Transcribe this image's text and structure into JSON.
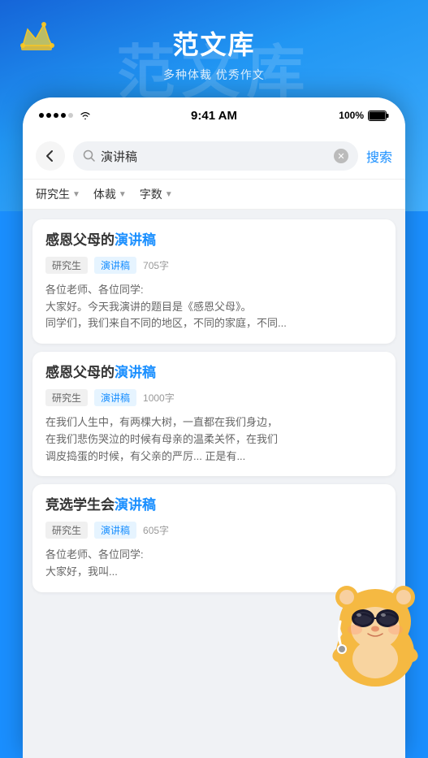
{
  "app": {
    "title": "范文库",
    "subtitle": "多种体裁 优秀作文",
    "watermark": "范文库"
  },
  "statusBar": {
    "time": "9:41 AM",
    "battery": "100%",
    "dots": [
      "•",
      "•",
      "•",
      "•",
      "•"
    ]
  },
  "search": {
    "placeholder": "演讲稿",
    "query": "演讲稿",
    "button": "搜索"
  },
  "filters": [
    {
      "label": "研究生",
      "id": "grade"
    },
    {
      "label": "体裁",
      "id": "genre"
    },
    {
      "label": "字数",
      "id": "wordcount"
    }
  ],
  "articles": [
    {
      "id": 1,
      "title_prefix": "感恩父母的",
      "title_highlight": "演讲稿",
      "tags": [
        "研究生",
        "演讲稿"
      ],
      "word_count": "705字",
      "preview": "各位老师、各位同学:\n大家好。今天我演讲的题目是《感恩父母》。\n同学们，我们来自不同的地区，不同的家庭，不同..."
    },
    {
      "id": 2,
      "title_prefix": "感恩父母的",
      "title_highlight": "演讲稿",
      "tags": [
        "研究生",
        "演讲稿"
      ],
      "word_count": "1000字",
      "preview": "在我们人生中，有两棵大树，一直都在我们身边，\n在我们悲伤哭泣的时候有母亲的温柔关怀，在我们\n调皮捣蛋的时候，有父亲的严厉... 正是有..."
    },
    {
      "id": 3,
      "title_prefix": "竞选学生会",
      "title_highlight": "演讲稿",
      "tags": [
        "研究生",
        "演讲稿"
      ],
      "word_count": "605字",
      "preview": "各位老师、各位同学:\n大家好，我叫..."
    }
  ],
  "mascot": {
    "alt": "hamster mascot character"
  }
}
